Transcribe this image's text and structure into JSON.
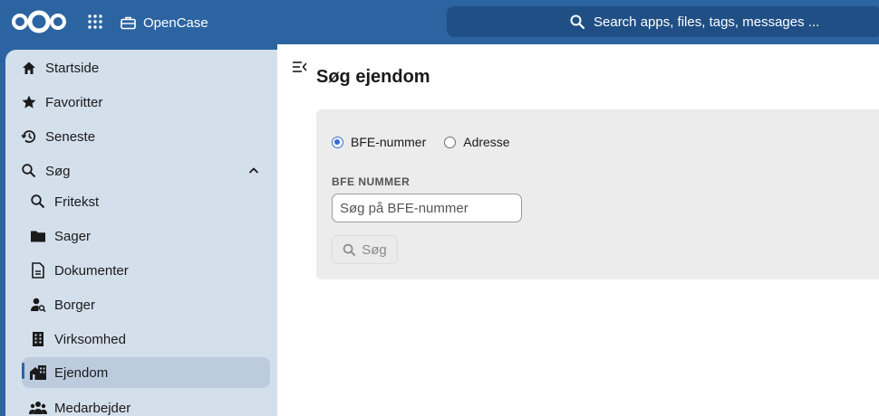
{
  "header": {
    "app_name": "OpenCase",
    "search_placeholder": "Search apps, files, tags, messages ..."
  },
  "sidebar": {
    "items": [
      {
        "label": "Startside",
        "icon": "home-icon"
      },
      {
        "label": "Favoritter",
        "icon": "star-icon"
      },
      {
        "label": "Seneste",
        "icon": "history-icon"
      },
      {
        "label": "Søg",
        "icon": "search-icon",
        "expanded": true
      },
      {
        "label": "Fritekst",
        "icon": "search-icon"
      },
      {
        "label": "Sager",
        "icon": "folder-icon"
      },
      {
        "label": "Dokumenter",
        "icon": "document-icon"
      },
      {
        "label": "Borger",
        "icon": "person-search-icon"
      },
      {
        "label": "Virksomhed",
        "icon": "building-icon"
      },
      {
        "label": "Ejendom",
        "icon": "property-icon",
        "active": true
      },
      {
        "label": "Medarbejder",
        "icon": "people-icon"
      }
    ]
  },
  "main": {
    "title": "Søg ejendom",
    "radio_options": [
      {
        "label": "BFE-nummer",
        "checked": true
      },
      {
        "label": "Adresse",
        "checked": false
      }
    ],
    "field_label": "BFE NUMMER",
    "input_placeholder": "Søg på BFE-nummer",
    "search_button": "Søg"
  },
  "colors": {
    "header_bg": "#2b64a0",
    "sidebar_bg": "#d4dfec",
    "active_item_bg": "#bccbde",
    "panel_bg": "#ececec",
    "radio_accent": "#2f6ed3"
  }
}
